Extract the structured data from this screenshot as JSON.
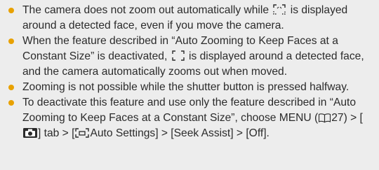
{
  "notes": [
    {
      "parts": [
        "The camera does not zoom out automatically while",
        "is displayed around a detected face, even if you move the camera."
      ]
    },
    {
      "parts": [
        "When the feature described in “Auto Zooming to Keep Faces at a Constant Size” is deactivated,",
        "is displayed around a detected face, and the camera automatically zooms out when moved."
      ]
    },
    {
      "parts": [
        "Zooming is not possible while the shutter button is pressed halfway."
      ]
    },
    {
      "parts": [
        "To deactivate this feature and use only the feature described in “Auto Zooming to Keep Faces at a Constant Size”, choose MENU (",
        "27) > [",
        "] tab > [",
        "Auto Settings] > [Seek Assist] > [Off]."
      ]
    }
  ],
  "icons": {
    "face_frame_dashed": "face-frame-dashed-icon",
    "face_frame_solid": "face-frame-solid-icon",
    "book": "book-icon",
    "camera_tab": "camera-tab-icon",
    "auto_zoom": "auto-zoom-frame-icon"
  },
  "colors": {
    "bullet": "#e8a100",
    "background": "#ededed",
    "text": "#2b2b2b"
  }
}
